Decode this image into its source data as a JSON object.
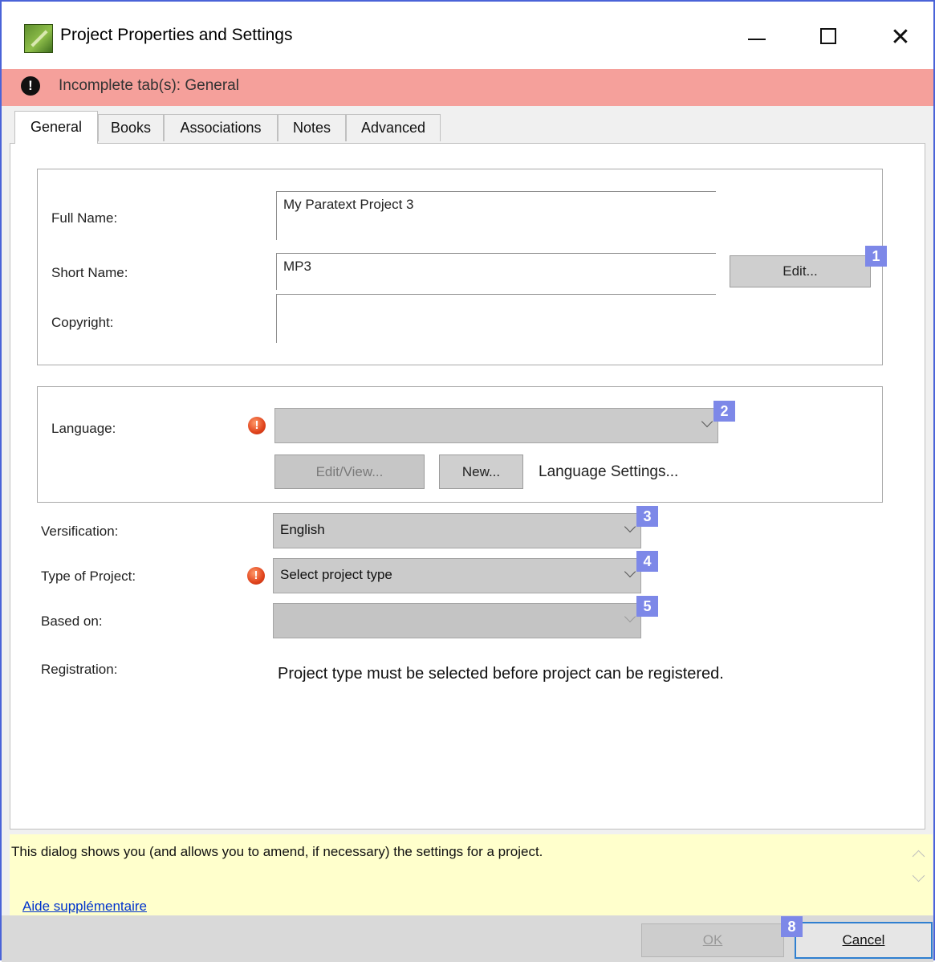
{
  "window": {
    "title": "Project Properties and Settings",
    "minimize_label": "",
    "maximize_label": "",
    "close_label": "✕"
  },
  "banner": {
    "icon": "!",
    "text": "Incomplete tab(s): General"
  },
  "tabs": [
    {
      "label": "General",
      "active": true
    },
    {
      "label": "Books"
    },
    {
      "label": "Associations"
    },
    {
      "label": "Notes"
    },
    {
      "label": "Advanced"
    }
  ],
  "names": {
    "full_name_label": "Full Name:",
    "full_name_value": "My Paratext Project 3",
    "short_name_label": "Short Name:",
    "short_name_value": "MP3",
    "edit_button": "Edit...",
    "copyright_label": "Copyright:",
    "copyright_value": ""
  },
  "language": {
    "label": "Language:",
    "selected": "",
    "edit_view_button": "Edit/View...",
    "new_button": "New...",
    "settings_link": "Language Settings..."
  },
  "versification": {
    "label": "Versification:",
    "selected": "English"
  },
  "project_type": {
    "label": "Type of Project:",
    "selected": "Select project type"
  },
  "based_on": {
    "label": "Based on:",
    "selected": ""
  },
  "registration": {
    "label": "Registration:",
    "text": "Project type must be selected before project can be registered."
  },
  "badges": [
    "1",
    "2",
    "3",
    "4",
    "5",
    "8"
  ],
  "help": {
    "text": "This dialog shows you (and allows you to amend, if necessary) the settings for a project.",
    "link": "Aide supplémentaire"
  },
  "footer": {
    "ok_button": "OK",
    "cancel_button": "Cancel"
  },
  "colors": {
    "banner": "#f5a09b",
    "help_background": "#ffffcc",
    "badge": "#7d88e8",
    "window_border": "#4a63d8"
  }
}
